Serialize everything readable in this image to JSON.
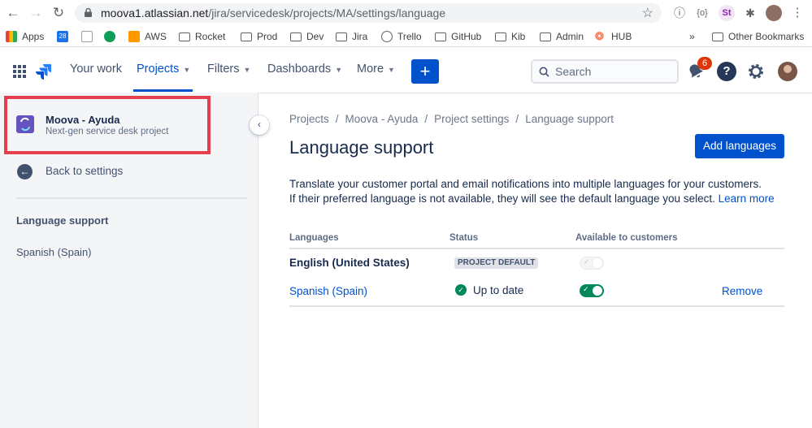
{
  "browser": {
    "url_host": "moova1.atlassian.net",
    "url_path": "/jira/servicedesk/projects/MA/settings/language",
    "bookmarks": [
      {
        "label": "Apps",
        "icon": "apps-grid-icon"
      },
      {
        "label": "28",
        "icon": "calendar-icon"
      },
      {
        "label": "",
        "icon": "document-icon"
      },
      {
        "label": "",
        "icon": "hangouts-icon"
      },
      {
        "label": "AWS",
        "icon": "aws-icon"
      },
      {
        "label": "Rocket",
        "icon": "folder-icon"
      },
      {
        "label": "Prod",
        "icon": "folder-icon"
      },
      {
        "label": "Dev",
        "icon": "folder-icon"
      },
      {
        "label": "Jira",
        "icon": "folder-icon"
      },
      {
        "label": "Trello",
        "icon": "globe-icon"
      },
      {
        "label": "GitHub",
        "icon": "folder-icon"
      },
      {
        "label": "Kib",
        "icon": "folder-icon"
      },
      {
        "label": "Admin",
        "icon": "folder-icon"
      },
      {
        "label": "HUB",
        "icon": "hubspot-icon"
      }
    ],
    "more_bookmarks": "»",
    "other_bookmarks": "Other Bookmarks"
  },
  "topnav": {
    "your_work": "Your work",
    "projects": "Projects",
    "filters": "Filters",
    "dashboards": "Dashboards",
    "more": "More",
    "create": "+",
    "search_placeholder": "Search",
    "notifications_count": "6",
    "help": "?"
  },
  "sidebar": {
    "project_name": "Moova - Ayuda",
    "project_type": "Next-gen service desk project",
    "back_label": "Back to settings",
    "section_heading": "Language support",
    "items": [
      {
        "label": "Spanish (Spain)"
      }
    ]
  },
  "main": {
    "breadcrumb": [
      "Projects",
      "Moova - Ayuda",
      "Project settings",
      "Language support"
    ],
    "title": "Language support",
    "add_button": "Add languages",
    "description_line1": "Translate your customer portal and email notifications into multiple languages for your customers.",
    "description_line2": "If their preferred language is not available, they will see the default language you select.",
    "learn_more": "Learn more",
    "table": {
      "headers": [
        "Languages",
        "Status",
        "Available to customers"
      ],
      "rows": [
        {
          "language": "English (United States)",
          "status": "PROJECT DEFAULT",
          "available": true,
          "toggle_disabled": true,
          "action": ""
        },
        {
          "language": "Spanish (Spain)",
          "status": "Up to date",
          "available": true,
          "toggle_disabled": false,
          "action": "Remove"
        }
      ]
    }
  },
  "colors": {
    "brand_blue": "#0052cc",
    "success_green": "#00875a",
    "notification_red": "#de350b",
    "highlight_red": "#e5404d"
  }
}
